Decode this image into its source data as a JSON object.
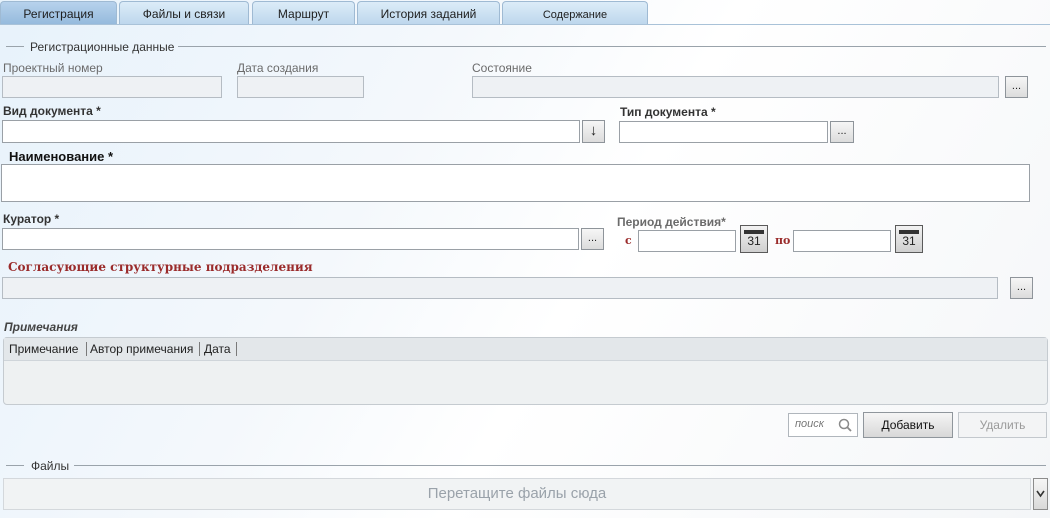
{
  "tabs": [
    {
      "label": "Регистрация",
      "active": true
    },
    {
      "label": "Файлы и связи"
    },
    {
      "label": "Маршрут"
    },
    {
      "label": "История заданий"
    },
    {
      "label": "Содержание"
    }
  ],
  "registration": {
    "group_title": "Регистрационные данные",
    "project_number_label": "Проектный номер",
    "creation_date_label": "Дата создания",
    "state_label": "Состояние",
    "doc_kind_label": "Вид документа  *",
    "doc_type_label": "Тип документа  *",
    "name_label": "Наименование *",
    "curator_label": "Куратор  *",
    "period_label": "Период действия*",
    "period_from": "с",
    "period_to": "по",
    "calendar_day": "31",
    "departments_label": "Согласующие структурные подразделения",
    "ellipsis": "...",
    "dropdown_arrow": "↓"
  },
  "notes": {
    "title": "Примечания",
    "columns": [
      "Примечание",
      "Автор примечания",
      "Дата"
    ],
    "search_placeholder": "поиск",
    "add_label": "Добавить",
    "delete_label": "Удалить"
  },
  "files": {
    "group_title": "Файлы",
    "drop_hint": "Перетащите файлы сюда"
  },
  "icons": {
    "search": "magnifier-icon",
    "calendar": "calendar-icon",
    "chevron": "chevron-down-icon"
  }
}
